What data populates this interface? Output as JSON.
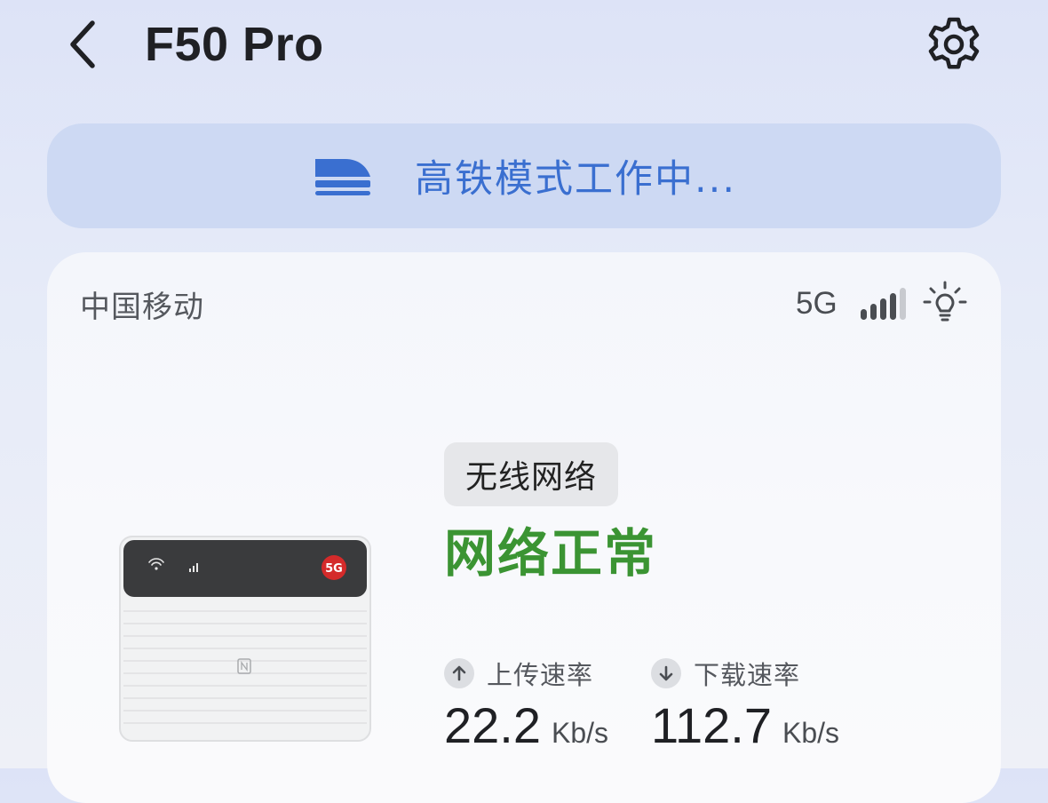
{
  "header": {
    "title": "F50 Pro"
  },
  "mode_banner": {
    "text": "高铁模式工作中...",
    "icon": "train-icon",
    "accent_color": "#3a6fd0"
  },
  "status_card": {
    "carrier": "中国移动",
    "network_type": "5G",
    "signal_icon": "signal-bars-icon",
    "signal_bars_active": 4,
    "signal_bars_total": 5,
    "light_icon": "lightbulb-icon",
    "connection_type": "无线网络",
    "connection_status": "网络正常",
    "status_color": "#3b9433",
    "device_badge": "5G",
    "upload": {
      "label": "上传速率",
      "value": "22.2",
      "unit": "Kb/s",
      "icon": "arrow-up-icon"
    },
    "download": {
      "label": "下载速率",
      "value": "112.7",
      "unit": "Kb/s",
      "icon": "arrow-down-icon"
    }
  }
}
